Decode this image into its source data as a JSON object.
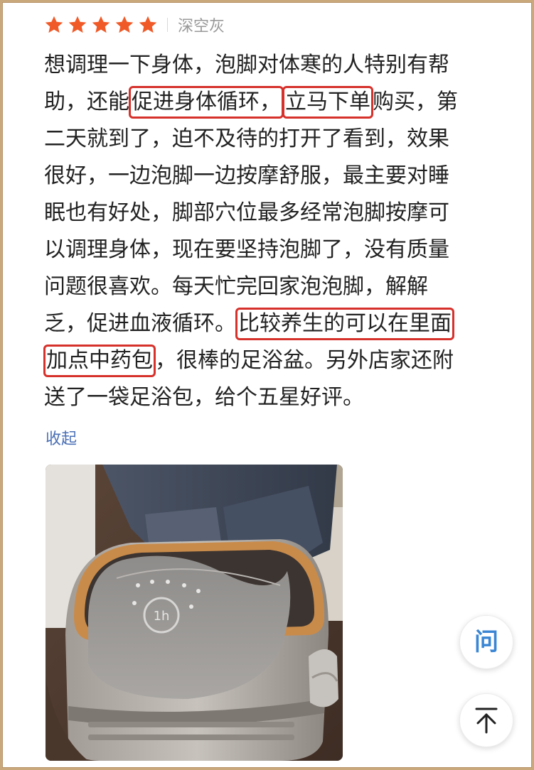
{
  "review": {
    "rating": 5,
    "rating_max": 5,
    "star_color": "#f05a28",
    "variant": "深空灰",
    "lines": [
      [
        "想调理一下身体，泡脚对体寒的人特别有帮"
      ],
      [
        "助，还能",
        "促进身体循环，",
        "立马下单",
        "购买，第"
      ],
      [
        "二天就到了，迫不及待的打开了看到，效果"
      ],
      [
        "很好，一边泡脚一边按摩舒服，最主要对睡"
      ],
      [
        "眠也有好处，脚部穴位最多经常泡脚按摩可"
      ],
      [
        "以调理身体，现在要坚持泡脚了，没有质量"
      ],
      [
        "问题很喜欢。每天忙完回家泡泡脚，解解"
      ],
      [
        "乏，促进血液循环。",
        "比较养生的可以在里面"
      ],
      [
        "加点中药包",
        "，很棒的足浴盆。另外店家还附"
      ],
      [
        "送了一袋足浴包，给个五星好评。"
      ]
    ],
    "highlight_color": "#d6312b",
    "collapse_label": "收起"
  },
  "photo": {
    "panel_text": "1h"
  },
  "float_buttons": {
    "ask_label": "问",
    "ask_color": "#3a86d4"
  }
}
